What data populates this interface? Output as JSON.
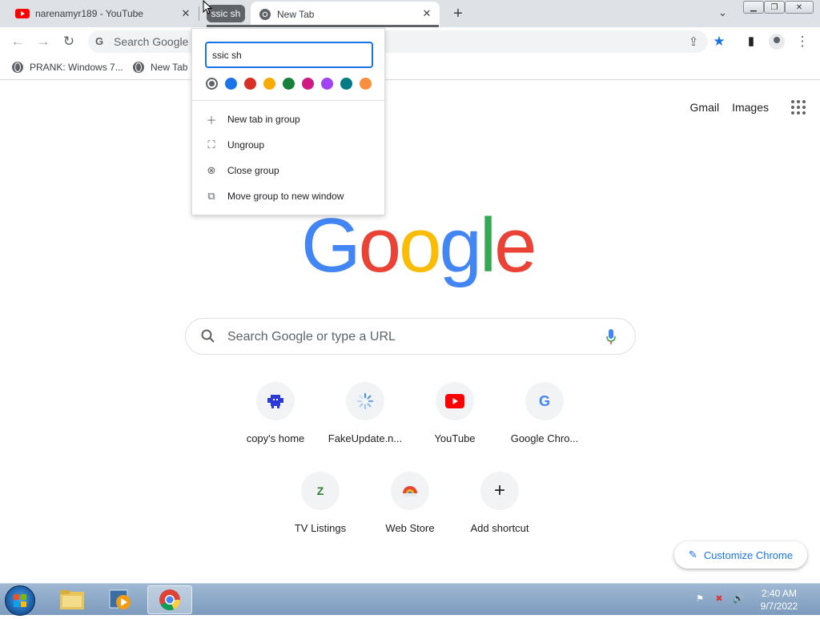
{
  "tabs": [
    {
      "title": "narenamyr189 - YouTube",
      "favicon": "youtube-icon"
    },
    {
      "title": "New Tab",
      "favicon": "chrome-icon"
    }
  ],
  "tab_group": {
    "name": "ssic sh"
  },
  "omnibox": {
    "text": "Search Google or type a URL"
  },
  "bookmarks": [
    {
      "label": "PRANK: Windows 7..."
    },
    {
      "label": "New Tab"
    }
  ],
  "top_links": {
    "gmail": "Gmail",
    "images": "Images"
  },
  "search": {
    "placeholder": "Search Google or type a URL"
  },
  "shortcuts": [
    {
      "label": "copy's home"
    },
    {
      "label": "FakeUpdate.n..."
    },
    {
      "label": "YouTube"
    },
    {
      "label": "Google Chro..."
    },
    {
      "label": "TV Listings"
    },
    {
      "label": "Web Store"
    },
    {
      "label": "Add shortcut"
    }
  ],
  "customize": {
    "label": "Customize Chrome"
  },
  "group_menu": {
    "name_value": "ssic sh",
    "colors": [
      "#5f6368",
      "#1a73e8",
      "#d93025",
      "#f9ab00",
      "#188038",
      "#d01884",
      "#a142f4",
      "#007b83",
      "#fa903e"
    ],
    "items": [
      {
        "label": "New tab in group",
        "icon": "plus-icon"
      },
      {
        "label": "Ungroup",
        "icon": "ungroup-icon"
      },
      {
        "label": "Close group",
        "icon": "close-circle-icon"
      },
      {
        "label": "Move group to new window",
        "icon": "move-window-icon"
      }
    ]
  },
  "taskbar": {
    "time": "2:40 AM",
    "date": "9/7/2022"
  }
}
